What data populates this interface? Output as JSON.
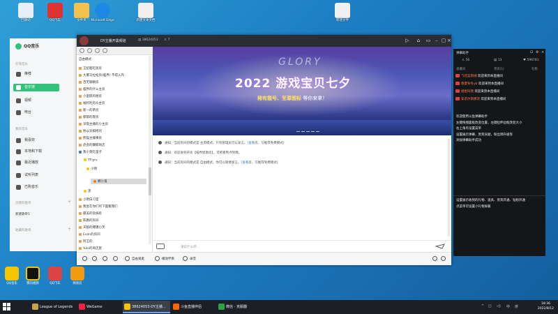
{
  "desktop": {
    "top_icons": [
      {
        "label": "回收站",
        "color": "#e6eef7"
      },
      {
        "label": "QQ飞车",
        "color": "#d33"
      },
      {
        "label": "文件夹",
        "color": "#f2c14e"
      },
      {
        "label": "Microsoft Edge",
        "color": "#1e88e5"
      },
      {
        "label": "新建文本文档",
        "color": "#f0f0f0"
      },
      {
        "label": "新建文件",
        "color": "#f0f0f0"
      }
    ],
    "bottom_icons": [
      {
        "label": "QQ音乐",
        "color": "#f7c600"
      },
      {
        "label": "腾讯视频",
        "color": "#111"
      },
      {
        "label": "QQ飞车",
        "color": "#d44"
      },
      {
        "label": "网易云",
        "color": "#f39c12"
      }
    ]
  },
  "qqmusic": {
    "app_name": "QQ音乐",
    "section_online": "在线音乐",
    "section_mine": "我的音乐",
    "section_created": "创建的歌单",
    "section_collected": "收藏的歌单",
    "online_items": [
      "推荐",
      "音乐馆",
      "视频",
      "电台"
    ],
    "active_item": "音乐馆",
    "mine_items": [
      "我喜欢",
      "本地和下载",
      "最近播放",
      "试听列表",
      "已购音乐"
    ],
    "playlist": "新建歌单1"
  },
  "main_window": {
    "title": "DY主播开黑频道",
    "room_id": "38624053",
    "members": "7",
    "left_list": [
      "自由模式",
      "王纪超吃饭房",
      "大厦马拉松房(临界) 不得入内",
      "百无聊赖房",
      "临界的什么主房",
      "小蛋糕的厨房",
      "福利社的众主房",
      "新一的茶房",
      "郁郁的客房",
      "深夜主播的小主房",
      "秋以天棋修的",
      "熊猫主播事房",
      "虎虎的懒鲸商店",
      "我小莫吃蛋子",
      "TFlyrs",
      "小明",
      "娜小鬼",
      "黑",
      "小明白习室",
      "我坐在你们的下面看我们",
      "最美的盐焗房",
      "陈鹏的房间",
      "天狼的爆爆小笑",
      "Evan的房间",
      "阿王的",
      "Yuki的商店屋",
      "阿文的茶室房",
      "好听勇主认真教我们",
      "小鸡绑的房"
    ],
    "banner": {
      "glory": "GLORY",
      "title": "2022 游戏宝贝七夕",
      "sub_pre": "稀有靓号、至尊图标",
      "sub_post": " 等你来拿！"
    },
    "notices": [
      {
        "text": "通知：当前房间的模式是 主席模式，只有管理员可以发言。",
        "link": "[查看",
        "tail": "房，写推荐免费模式]"
      },
      {
        "text": "通知：欢迎进到开房【临界屋歌房】，可把看熊点列哦。",
        "link": "",
        "tail": ""
      },
      {
        "text": "通知：当前房间的模式是 自由模式，你可以随便发言。",
        "link": "[查看",
        "tail": "房，写推荐免费模式]"
      }
    ],
    "input_placeholder": "请说什么吧…",
    "bottom_tools": [
      "自由发麦",
      "播放伴奏",
      "录音"
    ]
  },
  "right_panel": {
    "title": "弹幕助手",
    "stats": [
      "56",
      "13",
      "596781"
    ],
    "tabs": [
      "直播间",
      "贵宾(1)",
      "礼物",
      "关注(0)"
    ],
    "welcomes": [
      {
        "name": "飞花蓝雨绒",
        "msg": "欢迎来到本直播间"
      },
      {
        "name": "春夏秋冬yb",
        "msg": "欢迎来到本直播间"
      },
      {
        "name": "姐姐叫我",
        "msg": "欢迎来到本直播间"
      },
      {
        "name": "安诺尔斯那双",
        "msg": "欢迎来到本直播间"
      }
    ],
    "help_block": [
      "欢迎使用斗鱼弹幕助手",
      "左键拖拽面板改变位置，左键拉伸边框改变大小",
      "右上角有设置菜单",
      "设置展示弹幕、贵宾贡献，粉丝牌升级等",
      "添加弹幕助手成功"
    ],
    "bottom_block": [
      "设置展示收到的礼物、道具、贵宾开通、钻粉开通",
      "点菜单可设置小礼物屏蔽"
    ]
  },
  "taskbar": {
    "tasks": [
      {
        "label": "League of Legends",
        "color": "#c9a24a"
      },
      {
        "label": "WeGame",
        "color": "#e24"
      },
      {
        "label": "38624053-DY主播...",
        "color": "#f7c600"
      },
      {
        "label": "斗鱼直播伴侣",
        "color": "#f60"
      },
      {
        "label": "微信 - 克服器",
        "color": "#2ba245"
      }
    ],
    "time": "18:36",
    "date": "2022/8/12"
  }
}
